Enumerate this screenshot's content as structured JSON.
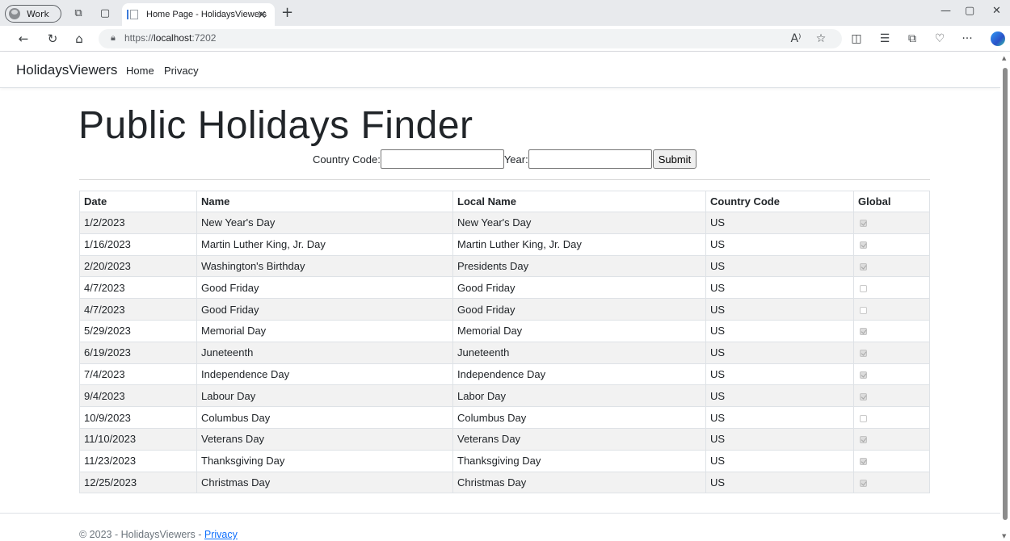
{
  "browser": {
    "profile_label": "Work",
    "tab_title": "Home Page - HolidaysViewers",
    "url_prefix": "https://",
    "url_host": "localhost",
    "url_port": ":7202"
  },
  "navbar": {
    "brand": "HolidaysViewers",
    "links": [
      "Home",
      "Privacy"
    ]
  },
  "main": {
    "title": "Public Holidays Finder",
    "form": {
      "country_code_label": "Country Code:",
      "country_code_value": "",
      "year_label": "Year:",
      "year_value": "",
      "submit_label": "Submit"
    },
    "table": {
      "headers": [
        "Date",
        "Name",
        "Local Name",
        "Country Code",
        "Global"
      ],
      "rows": [
        {
          "date": "1/2/2023",
          "name": "New Year's Day",
          "local": "New Year's Day",
          "cc": "US",
          "global": true
        },
        {
          "date": "1/16/2023",
          "name": "Martin Luther King, Jr. Day",
          "local": "Martin Luther King, Jr. Day",
          "cc": "US",
          "global": true
        },
        {
          "date": "2/20/2023",
          "name": "Washington's Birthday",
          "local": "Presidents Day",
          "cc": "US",
          "global": true
        },
        {
          "date": "4/7/2023",
          "name": "Good Friday",
          "local": "Good Friday",
          "cc": "US",
          "global": false
        },
        {
          "date": "4/7/2023",
          "name": "Good Friday",
          "local": "Good Friday",
          "cc": "US",
          "global": false
        },
        {
          "date": "5/29/2023",
          "name": "Memorial Day",
          "local": "Memorial Day",
          "cc": "US",
          "global": true
        },
        {
          "date": "6/19/2023",
          "name": "Juneteenth",
          "local": "Juneteenth",
          "cc": "US",
          "global": true
        },
        {
          "date": "7/4/2023",
          "name": "Independence Day",
          "local": "Independence Day",
          "cc": "US",
          "global": true
        },
        {
          "date": "9/4/2023",
          "name": "Labour Day",
          "local": "Labor Day",
          "cc": "US",
          "global": true
        },
        {
          "date": "10/9/2023",
          "name": "Columbus Day",
          "local": "Columbus Day",
          "cc": "US",
          "global": false
        },
        {
          "date": "11/10/2023",
          "name": "Veterans Day",
          "local": "Veterans Day",
          "cc": "US",
          "global": true
        },
        {
          "date": "11/23/2023",
          "name": "Thanksgiving Day",
          "local": "Thanksgiving Day",
          "cc": "US",
          "global": true
        },
        {
          "date": "12/25/2023",
          "name": "Christmas Day",
          "local": "Christmas Day",
          "cc": "US",
          "global": true
        }
      ]
    }
  },
  "footer": {
    "copyright": "© 2023 - HolidaysViewers - ",
    "privacy_link": "Privacy"
  },
  "colors": {
    "link": "#0d6efd",
    "stripe": "#f2f2f2",
    "border": "#dee2e6"
  }
}
